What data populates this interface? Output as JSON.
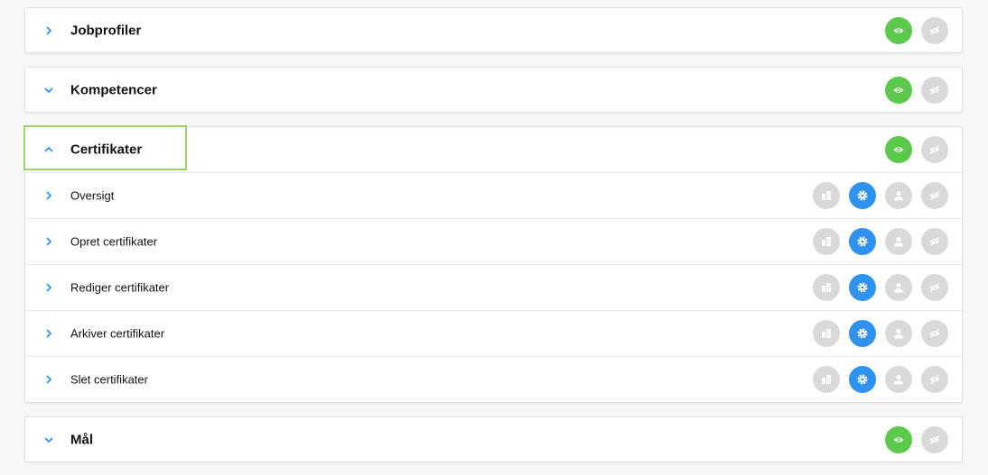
{
  "sections": [
    {
      "title": "Jobprofiler",
      "chevron_icon": "chevron-right-icon",
      "expanded": false,
      "actions": [
        {
          "icon": "eye-icon",
          "state": "active",
          "color": "#5cc84c"
        },
        {
          "icon": "eye-off-icon",
          "state": "inactive",
          "color": "#d9d9d9"
        }
      ]
    },
    {
      "title": "Kompetencer",
      "chevron_icon": "chevron-down-icon",
      "expanded": false,
      "actions": [
        {
          "icon": "eye-icon",
          "state": "active",
          "color": "#5cc84c"
        },
        {
          "icon": "eye-off-icon",
          "state": "inactive",
          "color": "#d9d9d9"
        }
      ]
    },
    {
      "title": "Certifikater",
      "chevron_icon": "chevron-up-icon",
      "expanded": true,
      "focused": true,
      "actions": [
        {
          "icon": "eye-icon",
          "state": "active",
          "color": "#5cc84c"
        },
        {
          "icon": "eye-off-icon",
          "state": "inactive",
          "color": "#d9d9d9"
        }
      ],
      "children": [
        {
          "label": "Oversigt"
        },
        {
          "label": "Opret certifikater"
        },
        {
          "label": "Rediger certifikater"
        },
        {
          "label": "Arkiver certifikater"
        },
        {
          "label": "Slet certifikater"
        }
      ],
      "child_actions": [
        {
          "icon": "building-icon",
          "state": "inactive",
          "color": "#d9d9d9"
        },
        {
          "icon": "gear-icon",
          "state": "active",
          "color": "#2e92ee"
        },
        {
          "icon": "user-icon",
          "state": "inactive",
          "color": "#d9d9d9"
        },
        {
          "icon": "eye-off-icon",
          "state": "inactive",
          "color": "#d9d9d9"
        }
      ]
    },
    {
      "title": "Mål",
      "chevron_icon": "chevron-down-icon",
      "expanded": false,
      "actions": [
        {
          "icon": "eye-icon",
          "state": "active",
          "color": "#5cc84c"
        },
        {
          "icon": "eye-off-icon",
          "state": "inactive",
          "color": "#d9d9d9"
        }
      ]
    }
  ],
  "colors": {
    "accent": "#2e92ee",
    "visible": "#5cc84c",
    "inactive": "#d9d9d9",
    "focus_outline": "#9cd36a"
  }
}
